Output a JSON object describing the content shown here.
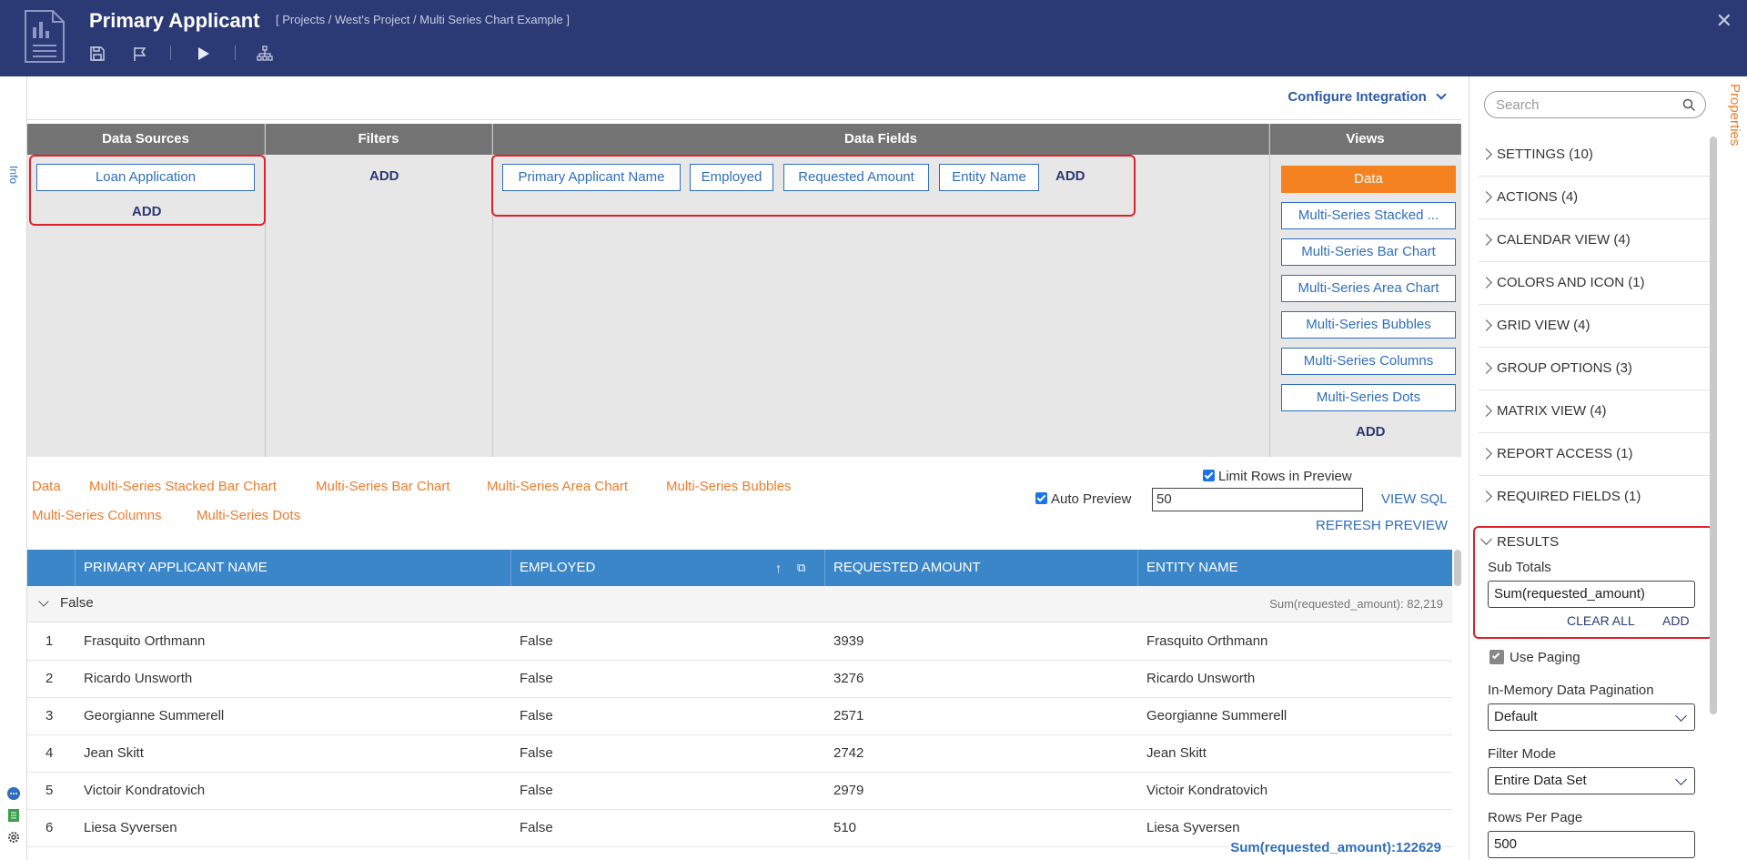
{
  "header": {
    "title": "Primary Applicant",
    "breadcrumb": "[ Projects / West's Project / Multi Series Chart Example ]",
    "close_label": "✕"
  },
  "leftbar": {
    "info_label": "Info"
  },
  "topbar": {
    "configure_label": "Configure Integration"
  },
  "panels": {
    "data_sources": {
      "title": "Data Sources",
      "items": [
        "Loan Application"
      ],
      "add": "ADD"
    },
    "filters": {
      "title": "Filters",
      "add": "ADD"
    },
    "data_fields": {
      "title": "Data Fields",
      "items": [
        "Primary Applicant Name",
        "Employed",
        "Requested Amount",
        "Entity Name"
      ],
      "add": "ADD"
    },
    "views": {
      "title": "Views",
      "active": "Data",
      "items": [
        "Multi-Series Stacked ...",
        "Multi-Series Bar Chart",
        "Multi-Series Area Chart",
        "Multi-Series Bubbles",
        "Multi-Series Columns",
        "Multi-Series Dots"
      ],
      "add": "ADD"
    }
  },
  "view_tabs": [
    "Data",
    "Multi-Series Stacked Bar Chart",
    "Multi-Series Bar Chart",
    "Multi-Series Area Chart",
    "Multi-Series Bubbles",
    "Multi-Series Columns",
    "Multi-Series Dots"
  ],
  "preview": {
    "limit_rows_label": "Limit Rows in Preview",
    "auto_preview_label": "Auto Preview",
    "rows_value": "50",
    "view_sql": "VIEW SQL",
    "refresh_preview": "REFRESH PREVIEW"
  },
  "grid": {
    "columns": [
      "PRIMARY APPLICANT NAME",
      "EMPLOYED",
      "REQUESTED AMOUNT",
      "ENTITY NAME"
    ],
    "group_label": "False",
    "group_total": "Sum(requested_amount): 82,219",
    "rows": [
      {
        "n": "1",
        "name": "Frasquito Orthmann",
        "employed": "False",
        "amount": "3939",
        "entity": "Frasquito Orthmann"
      },
      {
        "n": "2",
        "name": "Ricardo Unsworth",
        "employed": "False",
        "amount": "3276",
        "entity": "Ricardo Unsworth"
      },
      {
        "n": "3",
        "name": "Georgianne Summerell",
        "employed": "False",
        "amount": "2571",
        "entity": "Georgianne Summerell"
      },
      {
        "n": "4",
        "name": "Jean Skitt",
        "employed": "False",
        "amount": "2742",
        "entity": "Jean Skitt"
      },
      {
        "n": "5",
        "name": "Victoir Kondratovich",
        "employed": "False",
        "amount": "2979",
        "entity": "Victoir Kondratovich"
      },
      {
        "n": "6",
        "name": "Liesa Syversen",
        "employed": "False",
        "amount": "510",
        "entity": "Liesa Syversen"
      }
    ],
    "grand_total": "Sum(requested_amount):122629"
  },
  "properties": {
    "tab_label": "Properties",
    "search_placeholder": "Search",
    "sections": [
      "SETTINGS (10)",
      "ACTIONS (4)",
      "CALENDAR VIEW (4)",
      "COLORS AND ICON (1)",
      "GRID VIEW (4)",
      "GROUP OPTIONS (3)",
      "MATRIX VIEW (4)",
      "REPORT ACCESS (1)",
      "REQUIRED FIELDS (1)"
    ],
    "results": {
      "title": "RESULTS",
      "sub_totals_label": "Sub Totals",
      "sub_totals_value": "Sum(requested_amount)",
      "clear_all": "CLEAR ALL",
      "add": "ADD",
      "use_paging": "Use Paging",
      "pagination_label": "In-Memory Data Pagination",
      "pagination_value": "Default",
      "filter_mode_label": "Filter Mode",
      "filter_mode_value": "Entire Data Set",
      "rows_per_page_label": "Rows Per Page",
      "rows_per_page_value": "500"
    }
  },
  "colors": {
    "header_bg": "#2b3a75",
    "accent_orange": "#f07b2b",
    "link_blue": "#2f6ebd",
    "grid_header": "#3a86c8",
    "highlight_red": "#e0212b"
  }
}
